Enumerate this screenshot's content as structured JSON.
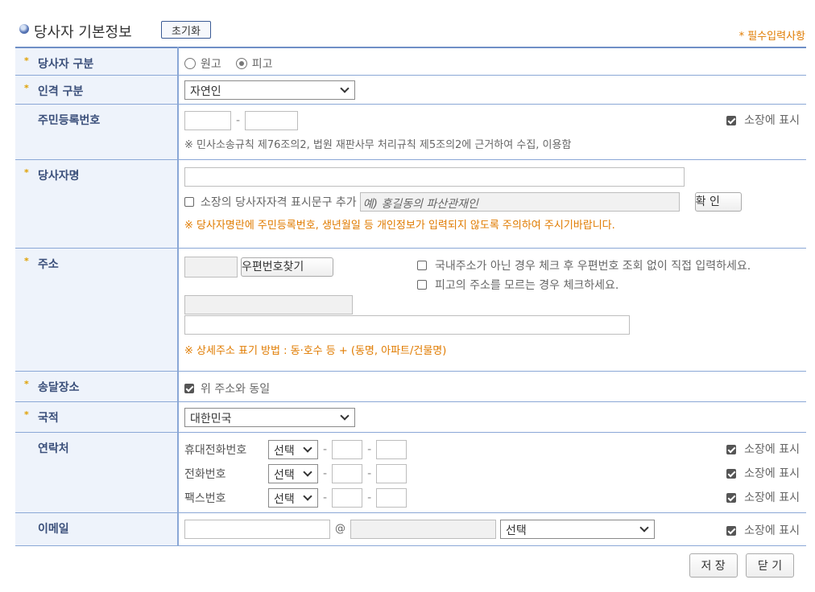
{
  "header": {
    "title": "당사자 기본정보",
    "reset_label": "초기화",
    "required_note": "* 필수입력사항"
  },
  "required_mark": "*",
  "show_in_complaint_label": "소장에 표시",
  "rows": {
    "party_type": {
      "label": "당사자 구분",
      "options": [
        "원고",
        "피고"
      ],
      "selected": "피고"
    },
    "person_type": {
      "label": "인격 구분",
      "value": "자연인"
    },
    "resident_number": {
      "label": "주민등록번호",
      "dash": "-",
      "note": "※ 민사소송규칙 제76조의2, 법원 재판사무 처리규칙 제5조의2에 근거하여 수집, 이용함",
      "show_checked": true
    },
    "party_name": {
      "label": "당사자명",
      "qualification_label": "소장의 당사자자격 표시문구 추가",
      "qualification_placeholder": "예) 홍길동의 파산관재인",
      "confirm_label": "확 인",
      "warning": "※ 당사자명란에 주민등록번호, 생년월일 등 개인정보가 입력되지 않도록 주의하여 주시기바랍니다."
    },
    "address": {
      "label": "주소",
      "postcode_button": "우편번호찾기",
      "foreign_check": "국내주소가 아닌 경우 체크 후 우편번호 조회 없이 직접 입력하세요.",
      "unknown_check": "피고의 주소를 모르는 경우 체크하세요.",
      "detail_note": "※ 상세주소 표기 방법 : 동·호수 등 + (동명, 아파트/건물명)"
    },
    "delivery": {
      "label": "송달장소",
      "same_label": "위 주소와 동일",
      "same_checked": true
    },
    "nationality": {
      "label": "국적",
      "value": "대한민국"
    },
    "contact": {
      "label": "연락처",
      "select_default": "선택",
      "dash": "-",
      "lines": [
        {
          "label": "휴대전화번호"
        },
        {
          "label": "전화번호"
        },
        {
          "label": "팩스번호"
        }
      ]
    },
    "email": {
      "label": "이메일",
      "at": "@",
      "domain_select": "선택"
    }
  },
  "footer": {
    "save_label": "저 장",
    "close_label": "닫 기"
  }
}
